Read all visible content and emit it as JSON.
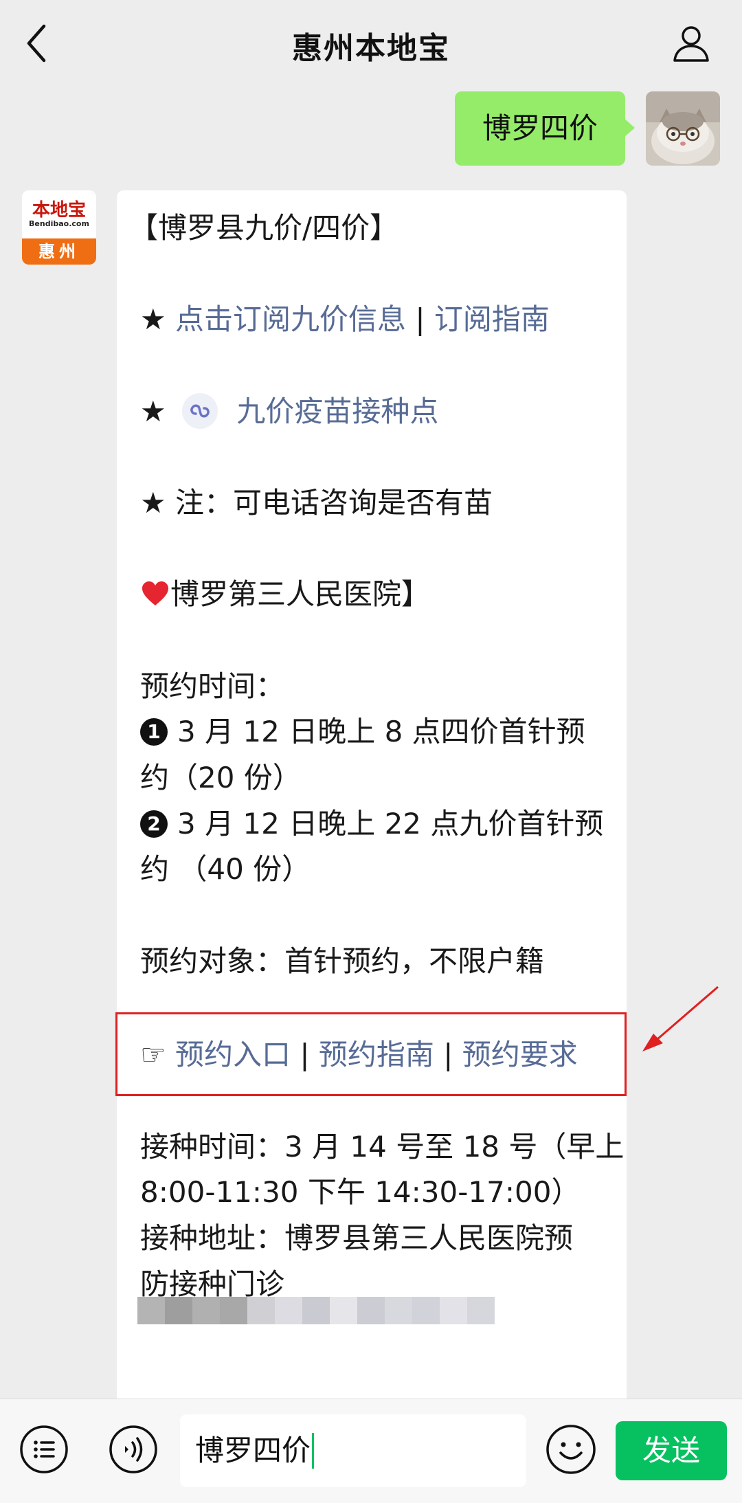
{
  "header": {
    "title": "惠州本地宝"
  },
  "outgoing": {
    "text": "博罗四价"
  },
  "bot": {
    "logo_name": "本地宝",
    "logo_domain": "Bendibao.com",
    "logo_city": "惠州"
  },
  "message": {
    "title": "【博罗县九价/四价】",
    "star": "★",
    "subscribe_link": "点击订阅九价信息",
    "separator": "|",
    "subscribe_guide": "订阅指南",
    "miniprogram_link": "九价疫苗接种点",
    "note": "注：可电话咨询是否有苗",
    "hospital": "博罗第三人民医院】",
    "appointment_time_label": "预约时间：",
    "item1_num": "1",
    "item1_line1": "3 月 12 日晚上 8 点四价首针预",
    "item1_line2": "约（20 份）",
    "item2_num": "2",
    "item2_line1": "3 月 12 日晚上 22 点九价首针预",
    "item2_line2": "约 （40 份）",
    "target": "预约对象：首针预约，不限户籍",
    "hand": "☞",
    "entry_link": "预约入口",
    "guide_link": "预约指南",
    "requirement_link": "预约要求",
    "vaccination_time_line1": "接种时间：3 月 14 号至 18 号（早上",
    "vaccination_time_line2": "8:00-11:30 下午 14:30-17:00）",
    "vaccination_address_line1": "接种地址：博罗县第三人民医院预",
    "vaccination_address_line2": "防接种门诊"
  },
  "input": {
    "value": "博罗四价"
  },
  "send_label": "发送",
  "colors": {
    "outgoing_bubble": "#95ec69",
    "link": "#576b95",
    "send_button": "#07c160",
    "highlight_box": "#e02020"
  },
  "icons": [
    "back-icon",
    "profile-icon",
    "miniprogram-icon",
    "heart-icon",
    "menu-icon",
    "voice-icon",
    "emoji-icon"
  ]
}
